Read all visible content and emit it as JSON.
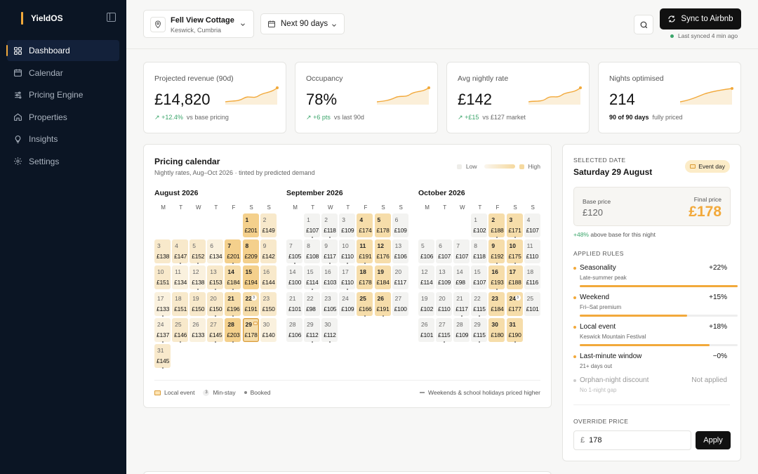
{
  "app": {
    "name": "YieldOS"
  },
  "nav": [
    {
      "label": "Dashboard",
      "icon": "dashboard-icon",
      "active": true
    },
    {
      "label": "Calendar",
      "icon": "calendar-icon"
    },
    {
      "label": "Pricing Engine",
      "icon": "sliders-icon"
    },
    {
      "label": "Properties",
      "icon": "home-icon"
    },
    {
      "label": "Insights",
      "icon": "lightbulb-icon"
    },
    {
      "label": "Settings",
      "icon": "gear-icon"
    }
  ],
  "header": {
    "property_name": "Fell View Cottage",
    "property_location": "Keswick, Cumbria",
    "range": "Next 90 days",
    "sync_label": "Sync to Airbnb",
    "last_synced": "Last synced 4 min ago"
  },
  "kpis": [
    {
      "label": "Projected revenue (90d)",
      "value": "£14,820",
      "delta": "+12.4%",
      "context": "vs base pricing"
    },
    {
      "label": "Occupancy",
      "value": "78%",
      "delta": "+6 pts",
      "context": "vs last 90d"
    },
    {
      "label": "Avg nightly rate",
      "value": "£142",
      "delta": "+£15",
      "context": "vs £127 market"
    },
    {
      "label": "Nights optimised",
      "value": "214",
      "strong": "90 of 90 days",
      "context": "fully priced"
    }
  ],
  "calendar": {
    "title": "Pricing calendar",
    "subtitle": "Nightly rates, Aug–Oct 2026 · tinted by predicted demand",
    "legend_low": "Low",
    "legend_high": "High",
    "weekdays": [
      "M",
      "T",
      "W",
      "T",
      "F",
      "S",
      "S"
    ],
    "months": [
      {
        "name": "August 2026",
        "offset": 5,
        "days": [
          [
            "1",
            "£201",
            4
          ],
          [
            "2",
            "£149",
            2
          ],
          [
            "3",
            "£138",
            2
          ],
          [
            "4",
            "£147",
            2
          ],
          [
            "5",
            "£152",
            2
          ],
          [
            "6",
            "£134",
            1
          ],
          [
            "7",
            "£201",
            4
          ],
          [
            "8",
            "£209",
            4
          ],
          [
            "9",
            "£142",
            2
          ],
          [
            "10",
            "£151",
            2
          ],
          [
            "11",
            "£134",
            1
          ],
          [
            "12",
            "£138",
            1
          ],
          [
            "13",
            "£153",
            2
          ],
          [
            "14",
            "£184",
            3
          ],
          [
            "15",
            "£194",
            4
          ],
          [
            "16",
            "£144",
            2
          ],
          [
            "17",
            "£133",
            1
          ],
          [
            "18",
            "£151",
            2
          ],
          [
            "19",
            "£150",
            2
          ],
          [
            "20",
            "£150",
            2
          ],
          [
            "21",
            "£196",
            3
          ],
          [
            "22",
            "£191",
            3
          ],
          [
            "23",
            "£150",
            2
          ],
          [
            "24",
            "£137",
            1
          ],
          [
            "25",
            "£146",
            2
          ],
          [
            "26",
            "£133",
            1
          ],
          [
            "27",
            "£145",
            2
          ],
          [
            "28",
            "£203",
            4
          ],
          [
            "29",
            "£178",
            3
          ],
          [
            "30",
            "£140",
            1
          ],
          [
            "31",
            "£145",
            2
          ]
        ]
      },
      {
        "name": "September 2026",
        "offset": 1,
        "days": [
          [
            "1",
            "£107",
            0
          ],
          [
            "2",
            "£118",
            0
          ],
          [
            "3",
            "£109",
            0
          ],
          [
            "4",
            "£174",
            3
          ],
          [
            "5",
            "£178",
            3
          ],
          [
            "6",
            "£109",
            0
          ],
          [
            "7",
            "£105",
            0
          ],
          [
            "8",
            "£108",
            0
          ],
          [
            "9",
            "£117",
            0
          ],
          [
            "10",
            "£110",
            0
          ],
          [
            "11",
            "£191",
            3
          ],
          [
            "12",
            "£176",
            3
          ],
          [
            "13",
            "£106",
            0
          ],
          [
            "14",
            "£100",
            0
          ],
          [
            "15",
            "£114",
            0
          ],
          [
            "16",
            "£103",
            0
          ],
          [
            "17",
            "£110",
            0
          ],
          [
            "18",
            "£178",
            3
          ],
          [
            "19",
            "£184",
            3
          ],
          [
            "20",
            "£117",
            0
          ],
          [
            "21",
            "£101",
            0
          ],
          [
            "22",
            "£98",
            0
          ],
          [
            "23",
            "£105",
            0
          ],
          [
            "24",
            "£109",
            0
          ],
          [
            "25",
            "£166",
            3
          ],
          [
            "26",
            "£191",
            3
          ],
          [
            "27",
            "£100",
            0
          ],
          [
            "28",
            "£106",
            0
          ],
          [
            "29",
            "£112",
            0
          ],
          [
            "30",
            "£112",
            0
          ]
        ]
      },
      {
        "name": "October 2026",
        "offset": 3,
        "days": [
          [
            "1",
            "£102",
            0
          ],
          [
            "2",
            "£188",
            3
          ],
          [
            "3",
            "£171",
            3
          ],
          [
            "4",
            "£107",
            0
          ],
          [
            "5",
            "£106",
            0
          ],
          [
            "6",
            "£107",
            0
          ],
          [
            "7",
            "£107",
            0
          ],
          [
            "8",
            "£118",
            0
          ],
          [
            "9",
            "£192",
            3
          ],
          [
            "10",
            "£175",
            3
          ],
          [
            "11",
            "£110",
            0
          ],
          [
            "12",
            "£114",
            0
          ],
          [
            "13",
            "£109",
            0
          ],
          [
            "14",
            "£98",
            0
          ],
          [
            "15",
            "£107",
            0
          ],
          [
            "16",
            "£193",
            3
          ],
          [
            "17",
            "£188",
            3
          ],
          [
            "18",
            "£116",
            0
          ],
          [
            "19",
            "£102",
            0
          ],
          [
            "20",
            "£110",
            0
          ],
          [
            "21",
            "£117",
            0
          ],
          [
            "22",
            "£115",
            0
          ],
          [
            "23",
            "£184",
            3
          ],
          [
            "24",
            "£177",
            3
          ],
          [
            "25",
            "£101",
            0
          ],
          [
            "26",
            "£101",
            0
          ],
          [
            "27",
            "£115",
            0
          ],
          [
            "28",
            "£109",
            0
          ],
          [
            "29",
            "£115",
            0
          ],
          [
            "30",
            "£180",
            3
          ],
          [
            "31",
            "£190",
            3
          ]
        ]
      }
    ],
    "footer": {
      "local_event": "Local event",
      "min_stay": "Min-stay",
      "min_stay_badge": "3",
      "booked": "Booked",
      "note": "Weekends & school holidays priced higher"
    }
  },
  "selected": {
    "caption": "SELECTED DATE",
    "date": "Saturday 29 August",
    "badge": "Event day",
    "base_label": "Base price",
    "base_value": "£120",
    "final_label": "Final price",
    "final_value": "£178",
    "above_delta": "+48%",
    "above_text": "above base for this night",
    "rules_caption": "APPLIED RULES",
    "rules": [
      {
        "name": "Seasonality",
        "desc": "Late-summer peak",
        "value": "+22%",
        "fill": 1.0
      },
      {
        "name": "Weekend",
        "desc": "Fri–Sat premium",
        "value": "+15%",
        "fill": 0.68
      },
      {
        "name": "Local event",
        "desc": "Keswick Mountain Festival",
        "value": "+18%",
        "fill": 0.82
      },
      {
        "name": "Last-minute window",
        "desc": "21+ days out",
        "value": "−0%",
        "fill": 0
      },
      {
        "name": "Orphan-night discount",
        "desc": "No 1-night gap",
        "value": "Not applied",
        "muted": true
      }
    ],
    "override_caption": "OVERRIDE PRICE",
    "override_currency": "£",
    "override_value": "178",
    "apply_label": "Apply"
  },
  "colors": {
    "accent": "#f2a93b",
    "sidebar": "#0b1524",
    "positive": "#3aa56a"
  }
}
